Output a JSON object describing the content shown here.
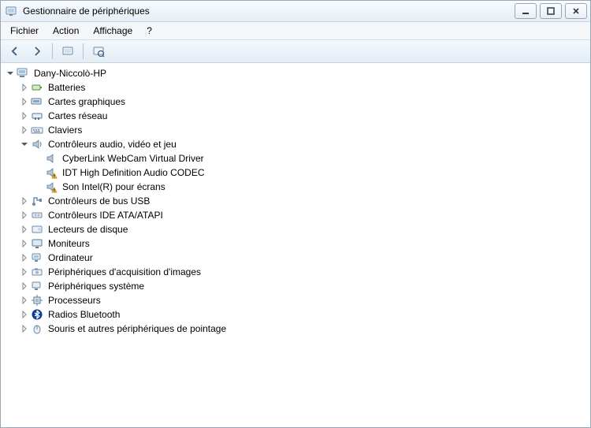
{
  "window": {
    "title": "Gestionnaire de périphériques"
  },
  "menu": {
    "file": "Fichier",
    "action": "Action",
    "view": "Affichage",
    "help": "?"
  },
  "toolbar": {
    "back": "Back",
    "forward": "Forward",
    "up": "Show hidden",
    "refresh": "Refresh",
    "properties": "Properties"
  },
  "tree": {
    "root": {
      "label": "Dany-Niccolò-HP",
      "expanded": true
    },
    "items": [
      {
        "label": "Batteries",
        "icon": "battery",
        "expanded": false
      },
      {
        "label": "Cartes graphiques",
        "icon": "display",
        "expanded": false
      },
      {
        "label": "Cartes réseau",
        "icon": "network",
        "expanded": false
      },
      {
        "label": "Claviers",
        "icon": "keyboard",
        "expanded": false
      },
      {
        "label": "Contrôleurs audio, vidéo et jeu",
        "icon": "audio",
        "expanded": true,
        "children": [
          {
            "label": "CyberLink WebCam Virtual Driver",
            "icon": "audio",
            "warn": false
          },
          {
            "label": "IDT High Definition Audio CODEC",
            "icon": "audio",
            "warn": true
          },
          {
            "label": "Son Intel(R) pour écrans",
            "icon": "audio",
            "warn": true
          }
        ]
      },
      {
        "label": "Contrôleurs de bus USB",
        "icon": "usb",
        "expanded": false
      },
      {
        "label": "Contrôleurs IDE ATA/ATAPI",
        "icon": "ide",
        "expanded": false
      },
      {
        "label": "Lecteurs de disque",
        "icon": "disk",
        "expanded": false
      },
      {
        "label": "Moniteurs",
        "icon": "monitor",
        "expanded": false
      },
      {
        "label": "Ordinateur",
        "icon": "computer",
        "expanded": false
      },
      {
        "label": "Périphériques d'acquisition d'images",
        "icon": "imaging",
        "expanded": false
      },
      {
        "label": "Périphériques système",
        "icon": "system",
        "expanded": false
      },
      {
        "label": "Processeurs",
        "icon": "cpu",
        "expanded": false
      },
      {
        "label": "Radios Bluetooth",
        "icon": "bluetooth",
        "expanded": false
      },
      {
        "label": "Souris et autres périphériques de pointage",
        "icon": "mouse",
        "expanded": false
      }
    ]
  },
  "colors": {
    "warning": "#f7c948",
    "twistyExpanded": "#4a5a6a",
    "twistyCollapsed": "#7a8a9a"
  }
}
